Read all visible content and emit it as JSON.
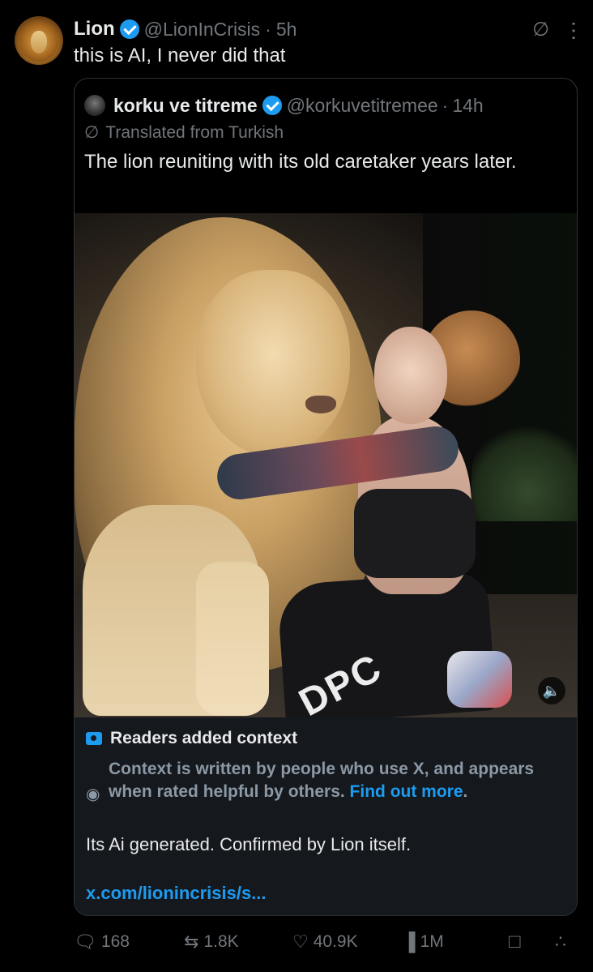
{
  "post": {
    "author_name": "Lion",
    "author_handle": "@LionInCrisis",
    "separator": "·",
    "time": "5h",
    "text": "this is AI, I never did that"
  },
  "quoted": {
    "author_name": "korku ve titreme",
    "author_handle": "@korkuvetitremee",
    "separator": "·",
    "time": "14h",
    "translated_label": "Translated from Turkish",
    "text": "The lion reuniting with its old caretaker years later.",
    "media_text": "DPC",
    "context": {
      "title": "Readers added context",
      "body": "Context is written by people who use X, and appears when rated helpful by others.",
      "find_out": "Find out more",
      "period": ".",
      "note": "Its Ai generated. Confirmed by Lion itself.",
      "link": "x.com/lionincrisis/s..."
    }
  },
  "actions": {
    "replies": "168",
    "reposts": "1.8K",
    "likes": "40.9K",
    "views": "1M"
  },
  "colors": {
    "background": "#000000",
    "accent": "#1d9bf0",
    "muted": "#71767b"
  },
  "icons": [
    "grok-icon",
    "more-icon",
    "verified-badge-icon",
    "translate-icon",
    "volume-icon",
    "context-icon",
    "eye-icon",
    "reply-icon",
    "repost-icon",
    "like-icon",
    "views-icon",
    "bookmark-icon",
    "share-icon"
  ]
}
